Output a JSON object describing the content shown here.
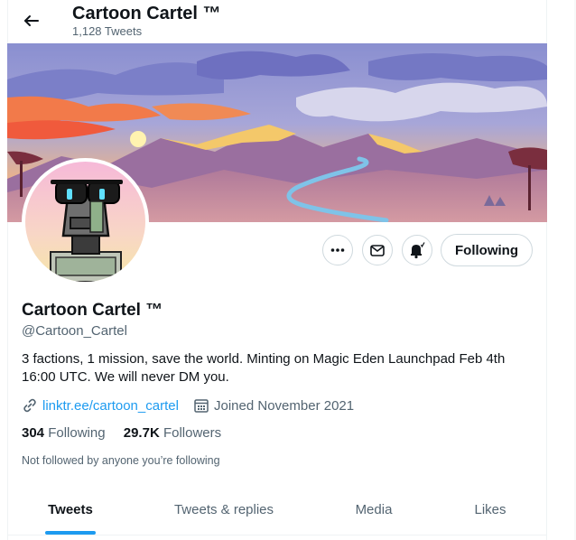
{
  "header": {
    "title": "Cartoon Cartel ™",
    "tweet_count": "1,128 Tweets"
  },
  "profile": {
    "name": "Cartoon Cartel ™",
    "handle": "@Cartoon_Cartel",
    "bio": "3 factions, 1 mission, save the world. Minting on Magic Eden Launchpad Feb 4th 16:00 UTC. We will never DM you.",
    "link": "linktr.ee/cartoon_cartel",
    "joined": "Joined November 2021",
    "following_count": "304",
    "following_label": "Following",
    "followers_count": "29.7K",
    "followers_label": "Followers",
    "not_followed": "Not followed by anyone you’re following"
  },
  "actions": {
    "follow_state_label": "Following"
  },
  "tabs": [
    {
      "label": "Tweets",
      "active": true
    },
    {
      "label": "Tweets & replies",
      "active": false
    },
    {
      "label": "Media",
      "active": false
    },
    {
      "label": "Likes",
      "active": false
    }
  ],
  "colors": {
    "accent": "#1d9bf0",
    "text_primary": "#0f1419",
    "text_secondary": "#536471",
    "border": "#cfd9de"
  },
  "icons": {
    "back": "arrow-left-icon",
    "more": "more-dots-icon",
    "message": "envelope-icon",
    "notify": "bell-plus-icon",
    "link": "link-icon",
    "calendar": "calendar-icon"
  }
}
